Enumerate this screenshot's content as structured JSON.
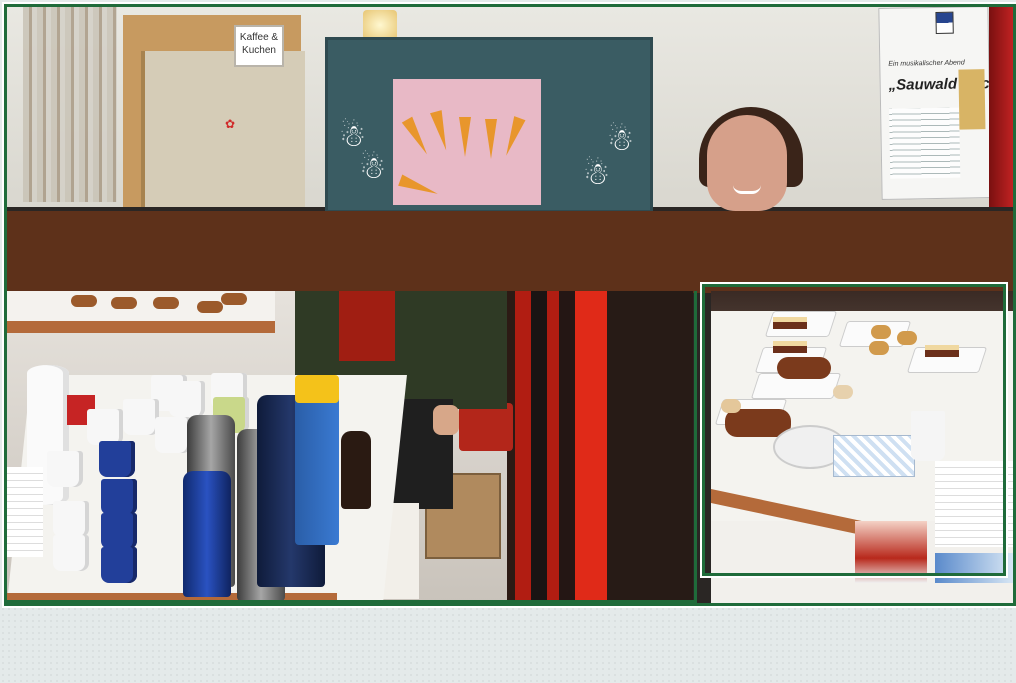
{
  "door_sign": {
    "line1": "Kaffee &",
    "line2": "Kuchen"
  },
  "flyer": {
    "pretitle": "Ein musikalischer Abend",
    "title": "„Sauwald Gschichten“"
  },
  "colors": {
    "frame": "#1f6b3a",
    "band": "#5e311a",
    "background": "#e4eaea"
  }
}
